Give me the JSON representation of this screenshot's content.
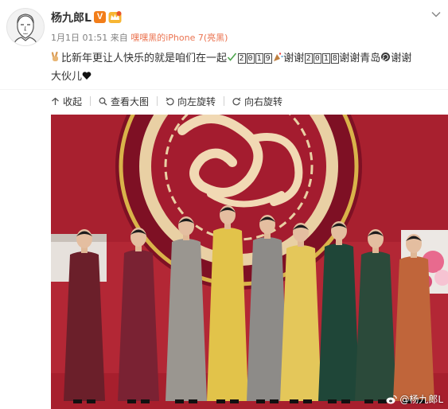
{
  "post": {
    "author": "杨九郎L",
    "verified_badge": "V",
    "time": "1月1日 01:51",
    "source_prefix": "来自",
    "source": "嘿嘿黑的iPhone 7(亮黑)",
    "text_part1": "比新年更让人快乐的就是咱们在一起",
    "digits_2019": [
      "2",
      "0",
      "1",
      "9"
    ],
    "text_part2": "谢谢",
    "digits_2018": [
      "2",
      "0",
      "1",
      "8"
    ],
    "text_part3": "谢谢青岛",
    "text_part4": "谢谢",
    "text_line2": "大伙儿"
  },
  "actions": {
    "collapse": "收起",
    "view_large": "查看大图",
    "rotate_left": "向左旋转",
    "rotate_right": "向右旋转"
  },
  "photo": {
    "watermark": "@杨九郎L",
    "robe_colors": [
      "#6b1f2a",
      "#7a2233",
      "#9a9690",
      "#e2c34a",
      "#8d8b88",
      "#e4c75a",
      "#1f4638",
      "#2b4a3a",
      "#c0653a"
    ]
  },
  "colors": {
    "accent": "#eb7350",
    "muted": "#808080",
    "badge_orange": "#f27e1a"
  }
}
